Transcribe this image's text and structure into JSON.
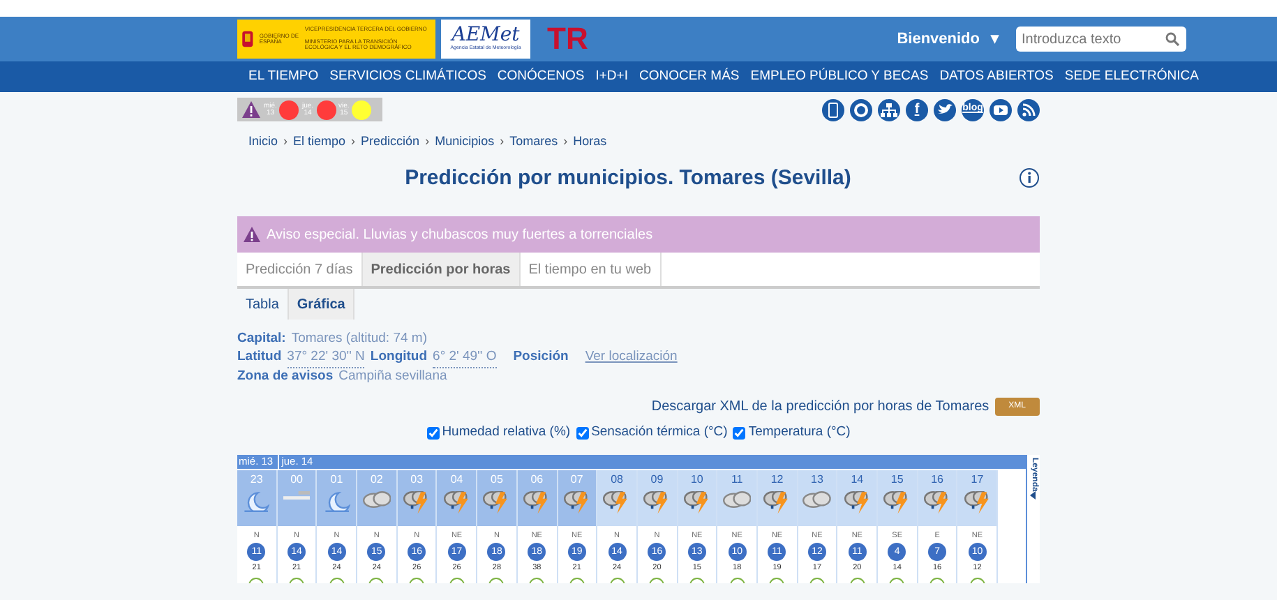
{
  "header": {
    "gov_logo": {
      "top": "GOBIERNO DE ESPAÑA",
      "line1": "VICEPRESIDENCIA TERCERA DEL GOBIERNO",
      "line2": "MINISTERIO PARA LA TRANSICIÓN ECOLÓGICA Y EL RETO DEMOGRÁFICO"
    },
    "aemet_logo": {
      "name": "AEMet",
      "subtitle": "Agencia Estatal de Meteorología"
    },
    "tr_logo": "TR",
    "user": "Bienvenido",
    "user_caret": "▾",
    "search": {
      "placeholder": "Introduzca texto"
    }
  },
  "nav": [
    "EL TIEMPO",
    "SERVICIOS CLIMÁTICOS",
    "CONÓCENOS",
    "I+D+I",
    "CONOCER MÁS",
    "EMPLEO PÚBLICO Y BECAS",
    "DATOS ABIERTOS",
    "SEDE ELECTRÓNICA"
  ],
  "warnings": [
    {
      "day": "mié.",
      "date": "13",
      "color": "#ff3b3b"
    },
    {
      "day": "jue.",
      "date": "14",
      "color": "#ff3b3b"
    },
    {
      "day": "vie.",
      "date": "15",
      "color": "#ffff33"
    }
  ],
  "social": [
    {
      "kind": "mobile"
    },
    {
      "kind": "ring"
    },
    {
      "kind": "sitemap"
    },
    {
      "kind": "f",
      "text": "f"
    },
    {
      "kind": "bird"
    },
    {
      "kind": "blog",
      "text": "blog"
    },
    {
      "kind": "play"
    },
    {
      "kind": "feed"
    }
  ],
  "breadcrumb": [
    {
      "label": "Inicio"
    },
    {
      "sep": "›",
      "label": "El tiempo"
    },
    {
      "sep": "›",
      "label": "Predicción"
    },
    {
      "sep": "›",
      "label": "Municipios"
    },
    {
      "sep": "›",
      "label": "Tomares"
    },
    {
      "sep": "›",
      "label": "Horas"
    }
  ],
  "title": "Predicción por municipios. Tomares (Sevilla)",
  "alert": "Aviso especial. Lluvias y chubascos muy fuertes a torrenciales",
  "tabs": [
    {
      "label": "Predicción 7 días",
      "selected": false
    },
    {
      "label": "Predicción por horas",
      "selected": true
    },
    {
      "label": "El tiempo en tu web",
      "selected": false
    }
  ],
  "subtabs": [
    {
      "label": "Tabla",
      "selected": false
    },
    {
      "label": "Gráfica",
      "selected": true
    }
  ],
  "info": {
    "capital_label": "Capital:",
    "capital": "Tomares (altitud: 74 m)",
    "lat_label": "Latitud",
    "lat": "37° 22' 30'' N",
    "lon_label": "Longitud",
    "lon": "6° 2' 49'' O",
    "pos_label": "Posición",
    "pos_link": "Ver localización",
    "zone_label": "Zona de avisos",
    "zone": "Campiña sevillana"
  },
  "download": {
    "text": "Descargar XML de la predicción por horas de Tomares",
    "button": "XML"
  },
  "toggles": [
    {
      "label": "Humedad relativa (%)",
      "checked": true
    },
    {
      "label": "Sensación térmica (°C)",
      "checked": true
    },
    {
      "label": "Temperatura (°C)",
      "checked": true
    }
  ],
  "forecast": {
    "days": [
      {
        "label": "mié. 13"
      },
      {
        "label": "jue. 14"
      }
    ],
    "legend": "Leyenda",
    "hours": [
      {
        "hour": "23",
        "night": true,
        "kind": "moon",
        "dir": "N",
        "wind": "11",
        "gust": "21"
      },
      {
        "hour": "00",
        "night": true,
        "kind": "fog",
        "dir": "N",
        "wind": "14",
        "gust": "21"
      },
      {
        "hour": "01",
        "night": true,
        "kind": "moon",
        "dir": "N",
        "wind": "14",
        "gust": "24"
      },
      {
        "hour": "02",
        "night": true,
        "kind": "cloud",
        "dir": "N",
        "wind": "15",
        "gust": "24"
      },
      {
        "hour": "03",
        "night": true,
        "kind": "storm",
        "dir": "N",
        "wind": "16",
        "gust": "26"
      },
      {
        "hour": "04",
        "night": true,
        "kind": "storm",
        "dir": "NE",
        "wind": "17",
        "gust": "26"
      },
      {
        "hour": "05",
        "night": true,
        "kind": "storm",
        "dir": "N",
        "wind": "18",
        "gust": "28"
      },
      {
        "hour": "06",
        "night": true,
        "kind": "storm",
        "dir": "NE",
        "wind": "18",
        "gust": "38"
      },
      {
        "hour": "07",
        "night": true,
        "kind": "storm",
        "dir": "NE",
        "wind": "19",
        "gust": "21"
      },
      {
        "hour": "08",
        "night": false,
        "kind": "storm",
        "dir": "N",
        "wind": "14",
        "gust": "24"
      },
      {
        "hour": "09",
        "night": false,
        "kind": "storm",
        "dir": "N",
        "wind": "16",
        "gust": "20"
      },
      {
        "hour": "10",
        "night": false,
        "kind": "storm",
        "dir": "NE",
        "wind": "13",
        "gust": "15"
      },
      {
        "hour": "11",
        "night": false,
        "kind": "cloud",
        "dir": "NE",
        "wind": "10",
        "gust": "18"
      },
      {
        "hour": "12",
        "night": false,
        "kind": "storm",
        "dir": "NE",
        "wind": "11",
        "gust": "19"
      },
      {
        "hour": "13",
        "night": false,
        "kind": "cloud",
        "dir": "NE",
        "wind": "12",
        "gust": "17"
      },
      {
        "hour": "14",
        "night": false,
        "kind": "storm",
        "dir": "NE",
        "wind": "11",
        "gust": "20"
      },
      {
        "hour": "15",
        "night": false,
        "kind": "storm",
        "dir": "SE",
        "wind": "4",
        "gust": "14"
      },
      {
        "hour": "16",
        "night": false,
        "kind": "storm",
        "dir": "E",
        "wind": "7",
        "gust": "16"
      },
      {
        "hour": "17",
        "night": false,
        "kind": "storm",
        "dir": "NE",
        "wind": "10",
        "gust": "12"
      }
    ]
  }
}
